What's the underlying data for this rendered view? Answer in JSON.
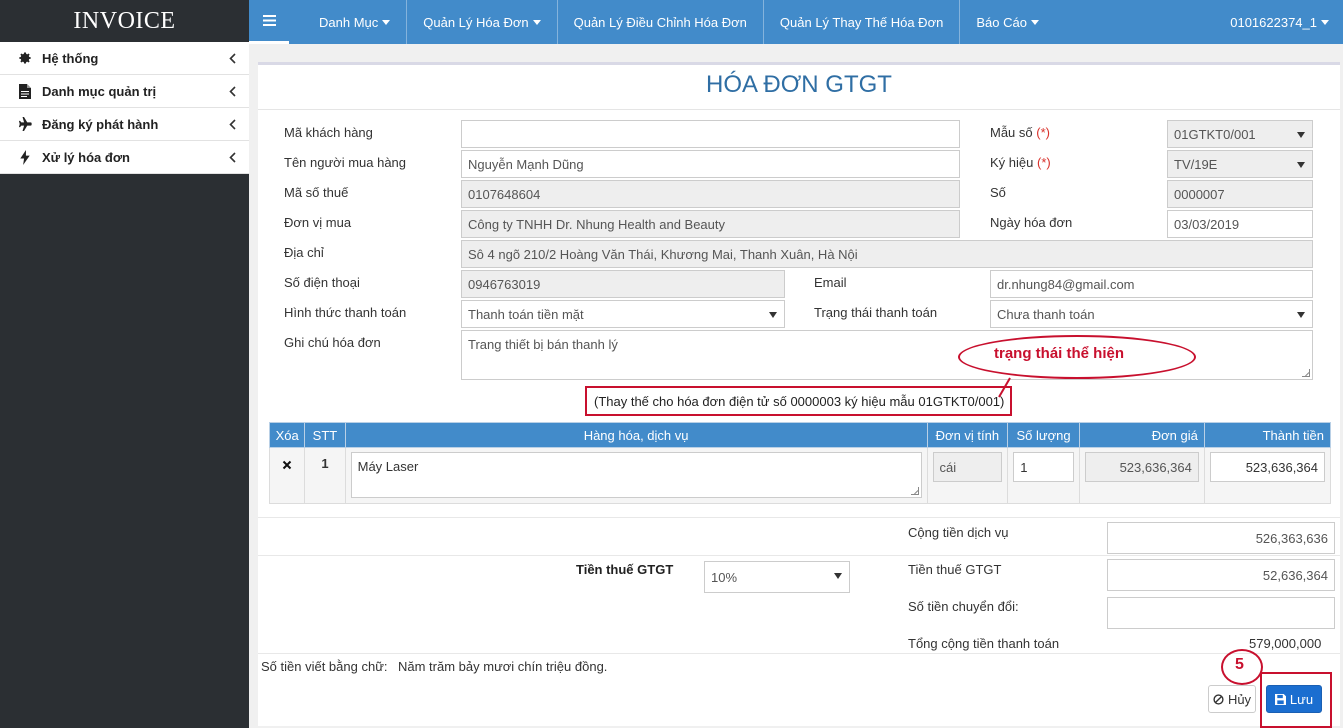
{
  "app": {
    "brand": "INVOICE"
  },
  "sidebar": {
    "items": [
      {
        "label": "Hệ thống",
        "icon": "gear-icon"
      },
      {
        "label": "Danh mục quản trị",
        "icon": "document-icon"
      },
      {
        "label": "Đăng ký phát hành",
        "icon": "plane-icon"
      },
      {
        "label": "Xử lý hóa đơn",
        "icon": "bolt-icon"
      }
    ]
  },
  "topnav": {
    "menu_icon": "hamburger-icon",
    "items": [
      {
        "label": "Danh Mục",
        "has_caret": true
      },
      {
        "label": "Quản Lý Hóa Đơn",
        "has_caret": true
      },
      {
        "label": "Quản Lý Điều Chỉnh Hóa Đơn",
        "has_caret": false
      },
      {
        "label": "Quản Lý Thay Thế Hóa Đơn",
        "has_caret": false
      },
      {
        "label": "Báo Cáo",
        "has_caret": true
      }
    ],
    "user": "0101622374_1"
  },
  "form": {
    "title": "HÓA ĐƠN GTGT",
    "required_mark": "(*)",
    "customer_code": {
      "label": "Mã khách hàng",
      "value": ""
    },
    "buyer_name": {
      "label": "Tên người mua hàng",
      "value": "Nguyễn Mạnh Dũng"
    },
    "tax_code": {
      "label": "Mã số thuế",
      "value": "0107648604"
    },
    "buyer_unit": {
      "label": "Đơn vị mua",
      "value": "Công ty TNHH Dr. Nhung Health and Beauty"
    },
    "address": {
      "label": "Địa chỉ",
      "value": "Sô 4 ngõ 210/2 Hoàng Văn Thái, Khương Mai, Thanh Xuân, Hà Nội"
    },
    "phone": {
      "label": "Số điện thoại",
      "value": "0946763019"
    },
    "email": {
      "label": "Email",
      "value": "dr.nhung84@gmail.com"
    },
    "payment_method": {
      "label": "Hình thức thanh toán",
      "value": "Thanh toán tiền mặt"
    },
    "payment_status": {
      "label": "Trạng thái thanh toán",
      "value": "Chưa thanh toán"
    },
    "note": {
      "label": "Ghi chú hóa đơn",
      "value": "Trang thiết bị bán thanh lý"
    },
    "template_no": {
      "label": "Mẫu số",
      "value": "01GTKT0/001"
    },
    "symbol": {
      "label": "Ký hiệu",
      "value": "TV/19E"
    },
    "number": {
      "label": "Số",
      "value": "0000007"
    },
    "invoice_date": {
      "label": "Ngày hóa đơn",
      "value": "03/03/2019"
    },
    "replacement_note": "(Thay thế cho hóa đơn điện tử số 0000003 ký hiệu mẫu 01GTKT0/001)"
  },
  "annotations": {
    "status_label": "trạng thái thể hiện",
    "step": "5"
  },
  "table": {
    "headers": [
      "Xóa",
      "STT",
      "Hàng hóa, dịch vụ",
      "Đơn vị tính",
      "Số lượng",
      "Đơn giá",
      "Thành tiền"
    ],
    "rows": [
      {
        "delete_icon": "close-icon",
        "stt": "1",
        "item": "Máy Laser",
        "unit": "cái",
        "qty": "1",
        "price": "523,636,364",
        "amount": "523,636,364"
      }
    ]
  },
  "totals": {
    "service_total": {
      "label": "Cộng tiền dịch vụ",
      "value": "526,363,636"
    },
    "vat_rate": {
      "label": "Tiền thuế GTGT",
      "value": "10%"
    },
    "vat_amount": {
      "label": "Tiền thuế GTGT",
      "value": "52,636,364"
    },
    "converted": {
      "label": "Số tiền chuyển đổi:",
      "value": ""
    },
    "grand_total": {
      "label": "Tổng cộng tiền thanh toán",
      "value": "579,000,000"
    },
    "in_words": {
      "label": "Số tiền viết bằng chữ:",
      "value": "Năm trăm bảy mươi chín triệu đồng."
    }
  },
  "actions": {
    "cancel": "Hủy",
    "save": "Lưu"
  }
}
